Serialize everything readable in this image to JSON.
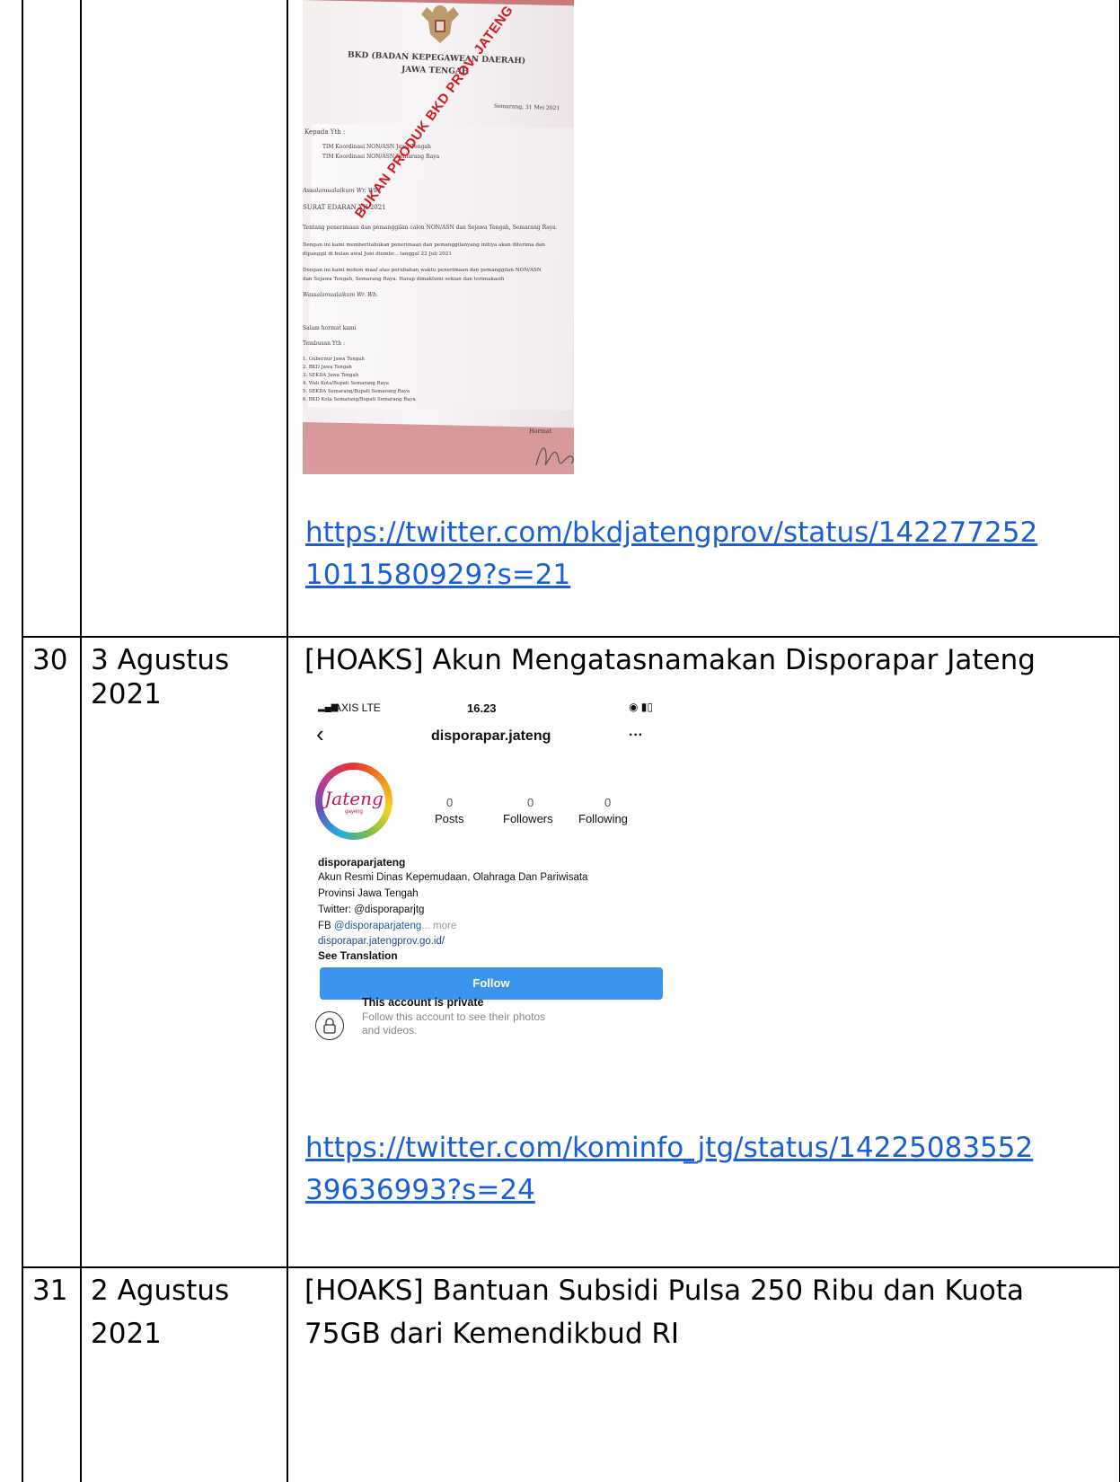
{
  "rows": [
    {
      "no": "",
      "date": "",
      "letter": {
        "header_line1": "BKD (BADAN KEPEGAWEAN DAERAH)",
        "header_line2": "JAWA TENGAH",
        "place_date": "Semarang, 31 Mei 2021",
        "kepada": "Kepada Yth :",
        "recipients": [
          "TIM Koordinasi NON/ASN Jawa Tengah",
          "TIM Koordinasi NON/ASN Semarang Raya"
        ],
        "salam": "Assalamualaikum Wr. Wb.",
        "surat": "SURAT EDARAN XII/2021",
        "body1": "Tentang penerimaan dan pemanggilan calon NON/ASN dan Sejawa Tengah, Semarang Raya.",
        "body2a": "Dengan ini kami memberitahukan penerimaan dan pemanggilanyang initiya akan diterima dan",
        "body2b": "dipanggil di bulan awal Juni diumbr... tanggal 22 Juli 2021",
        "body3a": "Dengan ini kami mohon maaf atas perubahan waktu penerimaan dan pemanggilan NON/ASN",
        "body3b": "dan Sejawa Tengah, Semarang Raya. Harap dimaklumi sekian dan terimakasih",
        "closing_salam": "Wassalamualaikum Wr. Wb.",
        "hormat": "Salam hormat kami",
        "tembusan": "Tembusan Yth :",
        "cc": [
          "1. Gubernur Jawa Tengah",
          "2. BKD Jawa Tengah",
          "3. SEKDA Jawa Tengah",
          "4. Wali Kota/Bupati Semarang Raya",
          "5. SEKDA Semarang/Bupati Semarang Raya",
          "6. BKD Kota Semarang/Bupati Semarang Raya"
        ],
        "signoff": "Hormat",
        "stamp": "BUKAN PRODUK BKD PROV. JATENG"
      },
      "link_line1": "https://twitter.com/bkdjatengprov/status/142277252",
      "link_line2": "1011580929?s=21"
    },
    {
      "no": "30",
      "date_line1": "3 Agustus",
      "date_line2": "2021",
      "title": "[HOAKS] Akun Mengatasnamakan Disporapar Jateng",
      "ig": {
        "carrier": "AXIS  LTE",
        "time": "16.23",
        "username": "disporapar.jateng",
        "more": "···",
        "logo_text": "Jateng",
        "logo_sub": "gayeng",
        "posts_count": "0",
        "posts_label": "Posts",
        "followers_count": "0",
        "followers_label": "Followers",
        "following_count": "0",
        "following_label": "Following",
        "name": "disporaparjateng",
        "bio1": "Akun Resmi Dinas Kepemudaan, Olahraga Dan Pariwisata",
        "bio2": "Provinsi Jawa Tengah",
        "bio3": "Twitter: @disporaparjtg",
        "bio4_prefix": "FB ",
        "bio4_handle": "@disporaparjateng",
        "bio4_more": "... more",
        "website": "disporapar.jatengprov.go.id/",
        "see_translation": "See Translation",
        "follow": "Follow",
        "private_title": "This account is private",
        "private_sub1": "Follow this account to see their photos",
        "private_sub2": "and videos."
      },
      "link_line1": "https://twitter.com/kominfo_jtg/status/14225083552",
      "link_line2": "39636993?s=24"
    },
    {
      "no": "31",
      "date_line1": "2 Agustus",
      "date_line2": "2021",
      "title_line1": "[HOAKS] Bantuan Subsidi Pulsa 250 Ribu dan Kuota",
      "title_line2": "75GB dari Kemendikbud RI"
    }
  ],
  "colors": {
    "link": "#1a5fd6",
    "stamp": "#d3191e",
    "follow": "#3b94ee"
  }
}
